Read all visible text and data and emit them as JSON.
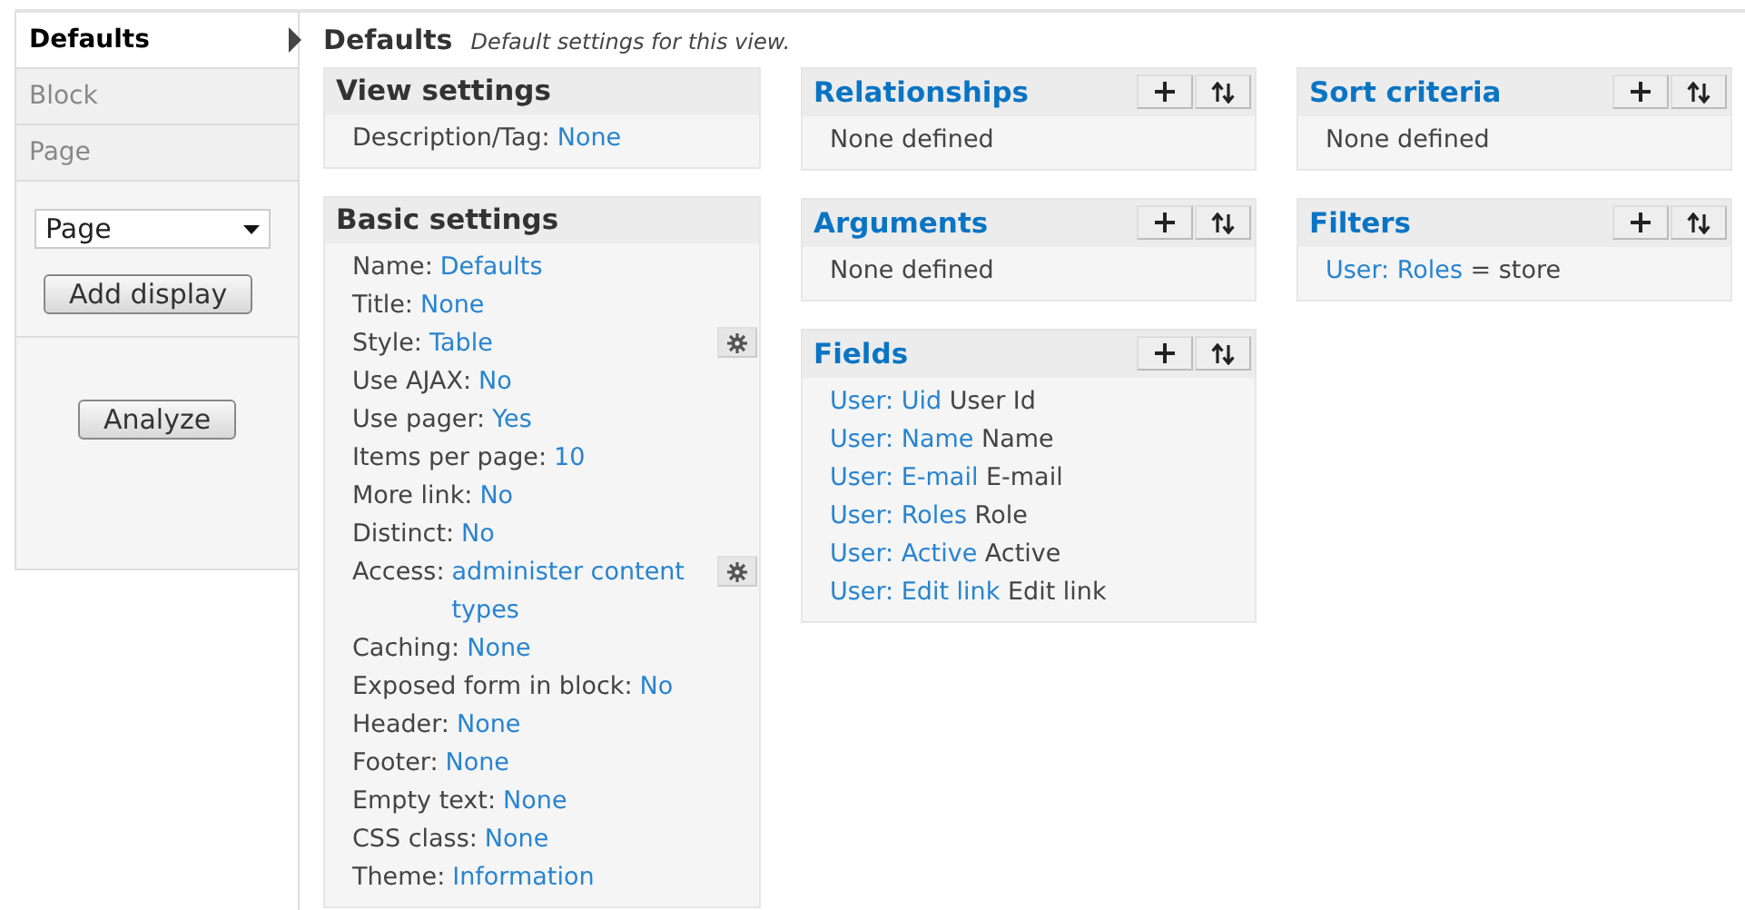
{
  "sidebar": {
    "displays": [
      {
        "label": "Defaults",
        "selected": true
      },
      {
        "label": "Block",
        "selected": false
      },
      {
        "label": "Page",
        "selected": false
      }
    ],
    "display_select": {
      "value": "Page"
    },
    "add_button": "Add display",
    "analyze_button": "Analyze"
  },
  "header": {
    "title": "Defaults",
    "description": "Default settings for this view."
  },
  "columns": [
    [
      {
        "title": "View settings",
        "kind": "settings",
        "items": [
          {
            "label": "Description/Tag:",
            "value": "None",
            "gear": false
          }
        ]
      },
      {
        "title": "Basic settings",
        "kind": "settings",
        "items": [
          {
            "label": "Name:",
            "value": "Defaults",
            "gear": false
          },
          {
            "label": "Title:",
            "value": "None",
            "gear": false
          },
          {
            "label": "Style:",
            "value": "Table",
            "gear": true
          },
          {
            "label": "Use AJAX:",
            "value": "No",
            "gear": false
          },
          {
            "label": "Use pager:",
            "value": "Yes",
            "gear": false
          },
          {
            "label": "Items per page:",
            "value": "10",
            "gear": false
          },
          {
            "label": "More link:",
            "value": "No",
            "gear": false
          },
          {
            "label": "Distinct:",
            "value": "No",
            "gear": false
          },
          {
            "label": "Access:",
            "value": "administer content types",
            "gear": true
          },
          {
            "label": "Caching:",
            "value": "None",
            "gear": false
          },
          {
            "label": "Exposed form in block:",
            "value": "No",
            "gear": false
          },
          {
            "label": "Header:",
            "value": "None",
            "gear": false
          },
          {
            "label": "Footer:",
            "value": "None",
            "gear": false
          },
          {
            "label": "Empty text:",
            "value": "None",
            "gear": false
          },
          {
            "label": "CSS class:",
            "value": "None",
            "gear": false
          },
          {
            "label": "Theme:",
            "value": "Information",
            "gear": false
          }
        ]
      }
    ],
    [
      {
        "title": "Relationships",
        "kind": "handlers",
        "items": [
          {
            "text": "None defined"
          }
        ]
      },
      {
        "title": "Arguments",
        "kind": "handlers",
        "items": [
          {
            "text": "None defined"
          }
        ]
      },
      {
        "title": "Fields",
        "kind": "handlers",
        "items": [
          {
            "link": "User: Uid",
            "text": "User Id"
          },
          {
            "link": "User: Name",
            "text": "Name"
          },
          {
            "link": "User: E-mail",
            "text": "E-mail"
          },
          {
            "link": "User: Roles",
            "text": "Role"
          },
          {
            "link": "User: Active",
            "text": "Active"
          },
          {
            "link": "User: Edit link",
            "text": "Edit link"
          }
        ]
      }
    ],
    [
      {
        "title": "Sort criteria",
        "kind": "handlers",
        "items": [
          {
            "text": "None defined"
          }
        ]
      },
      {
        "title": "Filters",
        "kind": "handlers",
        "items": [
          {
            "link": "User: Roles",
            "text": "= store"
          }
        ]
      }
    ]
  ]
}
